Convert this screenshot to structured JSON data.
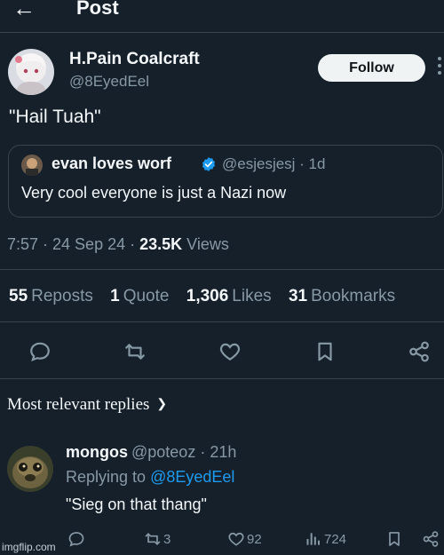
{
  "header": {
    "back_icon": "arrow-left-icon",
    "title": "Post"
  },
  "post": {
    "author_name": "H.Pain Coalcraft",
    "author_handle": "@8EyedEel",
    "follow_label": "Follow",
    "more_icon": "more-vertical-icon",
    "text": "\"Hail Tuah\"",
    "quote": {
      "author_name": "evan loves worf",
      "verified_icon": "verified-badge-icon",
      "handle_time": "@esjesjesj · 1d",
      "text": "Very cool everyone is just a Nazi now"
    },
    "meta": {
      "time_date": "7:57 · 24 Sep 24 · ",
      "views_count": "23.5K",
      "views_label": " Views"
    },
    "stats": [
      {
        "count": "55",
        "label": "Reposts"
      },
      {
        "count": "1",
        "label": "Quote"
      },
      {
        "count": "1,306",
        "label": "Likes"
      },
      {
        "count": "31",
        "label": "Bookmarks"
      }
    ],
    "actions": [
      "reply-icon",
      "repost-icon",
      "like-icon",
      "bookmark-icon",
      "share-icon"
    ]
  },
  "replies_section": {
    "label": "Most relevant replies",
    "chevron_icon": "chevron-down-icon"
  },
  "reply": {
    "author_name": "mongos",
    "handle_time": "@poteoz · 21h",
    "replying_prefix": "Replying to ",
    "replying_mention": "@8EyedEel",
    "text": "\"Sieg on that thang\"",
    "reposts": "3",
    "likes": "92",
    "views": "724"
  },
  "watermark": "imgflip.com",
  "colors": {
    "background": "#15202b",
    "text_primary": "#f5f8fa",
    "text_secondary": "#8899a6",
    "accent": "#1d9bf0",
    "divider": "#38444d",
    "follow_bg": "#eff3f4"
  }
}
